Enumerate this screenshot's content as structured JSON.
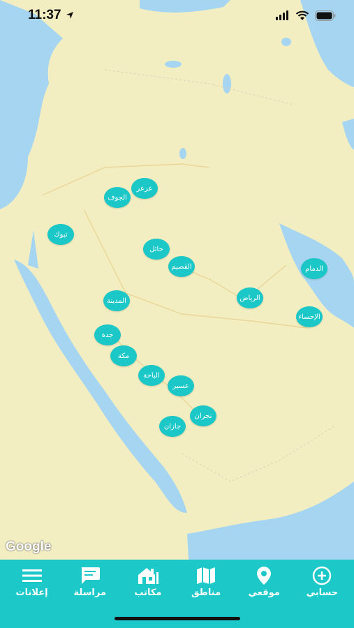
{
  "status": {
    "time": "11:37"
  },
  "map": {
    "attribution": "Google",
    "regions": [
      {
        "label": "عرعر"
      },
      {
        "label": "الجوف"
      },
      {
        "label": "تبوك"
      },
      {
        "label": "حائل"
      },
      {
        "label": "القصيم"
      },
      {
        "label": "الدمام"
      },
      {
        "label": "المدينة"
      },
      {
        "label": "الرياض"
      },
      {
        "label": "الإحساء"
      },
      {
        "label": "جدة"
      },
      {
        "label": "مكة"
      },
      {
        "label": "الباحة"
      },
      {
        "label": "عسير"
      },
      {
        "label": "نجران"
      },
      {
        "label": "جازان"
      }
    ]
  },
  "tabbar": {
    "items": [
      {
        "label": "إعلانات",
        "icon": "menu-icon"
      },
      {
        "label": "مراسلة",
        "icon": "chat-icon"
      },
      {
        "label": "مكاتب",
        "icon": "office-icon"
      },
      {
        "label": "مناطق",
        "icon": "map-icon"
      },
      {
        "label": "موقعي",
        "icon": "location-pin-icon"
      },
      {
        "label": "حسابي",
        "icon": "add-circle-icon"
      }
    ]
  },
  "colors": {
    "accent": "#1cc8c8",
    "water": "#a5d5f0",
    "land": "#f3eec2"
  }
}
